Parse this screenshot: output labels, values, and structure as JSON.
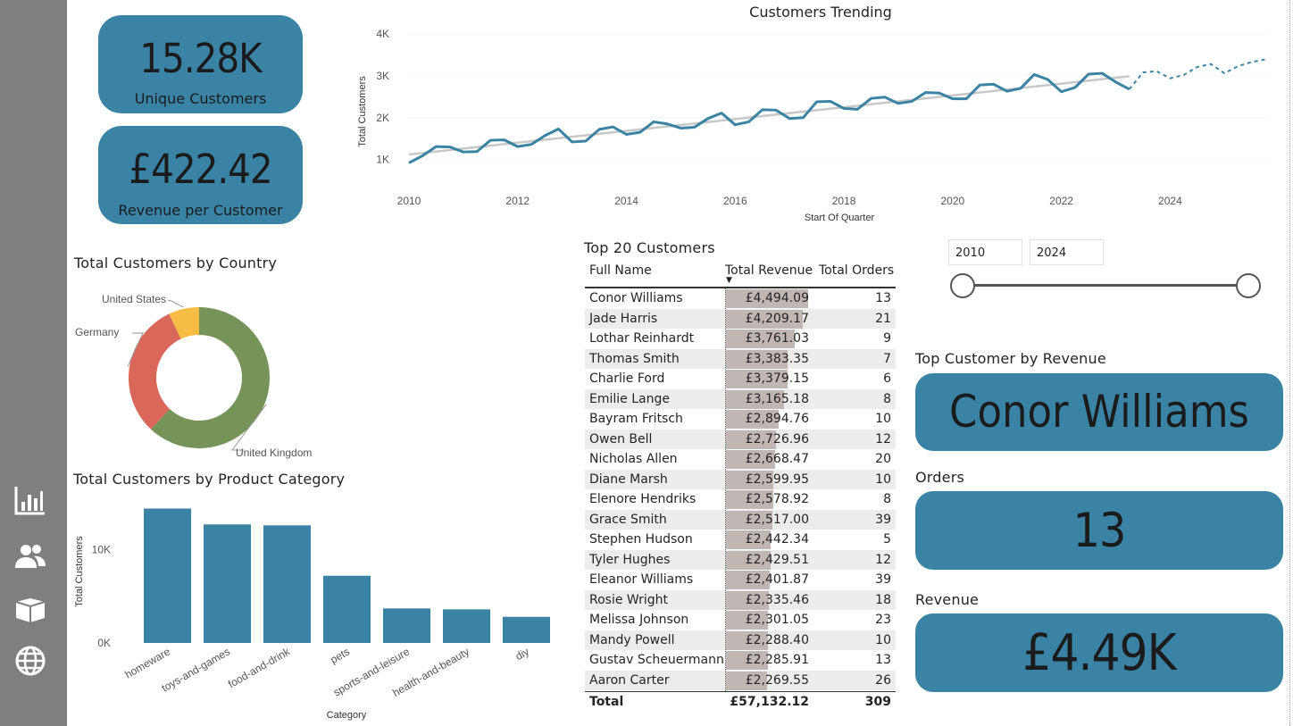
{
  "kpis": {
    "unique_customers_value": "15.28K",
    "unique_customers_label": "Unique Customers",
    "revenue_per_customer_value": "£422.42",
    "revenue_per_customer_label": "Revenue per Customer"
  },
  "nav": {
    "items": [
      {
        "icon": "bar-chart-icon"
      },
      {
        "icon": "users-icon"
      },
      {
        "icon": "box-icon"
      },
      {
        "icon": "globe-icon"
      }
    ]
  },
  "colors": {
    "accent": "#3b83a4",
    "sidebar": "#7f7f7f",
    "donut_uk": "#76935a",
    "donut_germany": "#d9685b",
    "donut_us": "#f7bc45",
    "trend_line": "#c8c8c8",
    "table_bar": "#c0b6b4"
  },
  "date_slicer": {
    "start": "2010",
    "end": "2024",
    "start_fraction": 0,
    "end_fraction": 1
  },
  "top_customer": {
    "title": "Top Customer by Revenue",
    "name": "Conor Williams",
    "orders_title": "Orders",
    "orders_value": "13",
    "revenue_title": "Revenue",
    "revenue_value": "£4.49K"
  },
  "top20": {
    "title": "Top 20 Customers",
    "columns": [
      "Full Name",
      "Total Revenue",
      "Total Orders"
    ],
    "sort_indicator": "▼",
    "rows": [
      {
        "name": "Conor Williams",
        "revenue": "£4,494.09",
        "revenue_num": 4494.09,
        "orders": "13"
      },
      {
        "name": "Jade Harris",
        "revenue": "£4,209.17",
        "revenue_num": 4209.17,
        "orders": "21"
      },
      {
        "name": "Lothar Reinhardt",
        "revenue": "£3,761.03",
        "revenue_num": 3761.03,
        "orders": "9"
      },
      {
        "name": "Thomas Smith",
        "revenue": "£3,383.35",
        "revenue_num": 3383.35,
        "orders": "7"
      },
      {
        "name": "Charlie Ford",
        "revenue": "£3,379.15",
        "revenue_num": 3379.15,
        "orders": "6"
      },
      {
        "name": "Emilie Lange",
        "revenue": "£3,165.18",
        "revenue_num": 3165.18,
        "orders": "8"
      },
      {
        "name": "Bayram Fritsch",
        "revenue": "£2,894.76",
        "revenue_num": 2894.76,
        "orders": "10"
      },
      {
        "name": "Owen Bell",
        "revenue": "£2,726.96",
        "revenue_num": 2726.96,
        "orders": "12"
      },
      {
        "name": "Nicholas Allen",
        "revenue": "£2,668.47",
        "revenue_num": 2668.47,
        "orders": "20"
      },
      {
        "name": "Diane Marsh",
        "revenue": "£2,599.95",
        "revenue_num": 2599.95,
        "orders": "10"
      },
      {
        "name": "Elenore Hendriks",
        "revenue": "£2,578.92",
        "revenue_num": 2578.92,
        "orders": "8"
      },
      {
        "name": "Grace Smith",
        "revenue": "£2,517.00",
        "revenue_num": 2517.0,
        "orders": "39"
      },
      {
        "name": "Stephen Hudson",
        "revenue": "£2,442.34",
        "revenue_num": 2442.34,
        "orders": "5"
      },
      {
        "name": "Tyler Hughes",
        "revenue": "£2,429.51",
        "revenue_num": 2429.51,
        "orders": "12"
      },
      {
        "name": "Eleanor Williams",
        "revenue": "£2,401.87",
        "revenue_num": 2401.87,
        "orders": "39"
      },
      {
        "name": "Rosie Wright",
        "revenue": "£2,335.46",
        "revenue_num": 2335.46,
        "orders": "18"
      },
      {
        "name": "Melissa Johnson",
        "revenue": "£2,301.05",
        "revenue_num": 2301.05,
        "orders": "23"
      },
      {
        "name": "Mandy Powell",
        "revenue": "£2,288.40",
        "revenue_num": 2288.4,
        "orders": "10"
      },
      {
        "name": "Gustav Scheuermann",
        "revenue": "£2,285.91",
        "revenue_num": 2285.91,
        "orders": "13"
      },
      {
        "name": "Aaron Carter",
        "revenue": "£2,269.55",
        "revenue_num": 2269.55,
        "orders": "26"
      }
    ],
    "total_label": "Total",
    "total_revenue": "£57,132.12",
    "total_orders": "309"
  },
  "chart_data": [
    {
      "type": "line",
      "title": "Customers Trending",
      "xlabel": "Start Of Quarter",
      "ylabel": "Total Customers",
      "x_ticks": [
        "2010",
        "2012",
        "2014",
        "2016",
        "2018",
        "2020",
        "2022",
        "2024"
      ],
      "y_ticks": [
        "1K",
        "2K",
        "3K",
        "4K"
      ],
      "xlim": [
        2010,
        2025.8
      ],
      "ylim": [
        800,
        4000
      ],
      "series": [
        {
          "values_x": [
            2010.0,
            2010.25,
            2010.5,
            2010.75,
            2011.0,
            2011.25,
            2011.5,
            2011.75,
            2012.0,
            2012.25,
            2012.5,
            2012.75,
            2013.0,
            2013.25,
            2013.5,
            2013.75,
            2014.0,
            2014.25,
            2014.5,
            2014.75,
            2015.0,
            2015.25,
            2015.5,
            2015.75,
            2016.0,
            2016.25,
            2016.5,
            2016.75,
            2017.0,
            2017.25,
            2017.5,
            2017.75,
            2018.0,
            2018.25,
            2018.5,
            2018.75,
            2019.0,
            2019.25,
            2019.5,
            2019.75,
            2020.0,
            2020.25,
            2020.5,
            2020.75,
            2021.0,
            2021.25,
            2021.5,
            2021.75,
            2022.0,
            2022.25,
            2022.5,
            2022.75,
            2023.0,
            2023.25
          ],
          "values_y": [
            920,
            1090,
            1310,
            1300,
            1180,
            1190,
            1460,
            1470,
            1310,
            1360,
            1570,
            1730,
            1420,
            1440,
            1720,
            1780,
            1600,
            1650,
            1900,
            1850,
            1750,
            1770,
            1980,
            2110,
            1830,
            1900,
            2190,
            2180,
            1980,
            2000,
            2380,
            2390,
            2220,
            2200,
            2460,
            2490,
            2340,
            2390,
            2600,
            2590,
            2450,
            2450,
            2780,
            2800,
            2630,
            2700,
            3030,
            2910,
            2620,
            2720,
            3040,
            3060,
            2850,
            2680
          ]
        },
        {
          "forecast_x": [
            2023.25,
            2023.5,
            2023.75,
            2024.0,
            2024.25,
            2024.5,
            2024.75,
            2025.0,
            2025.25,
            2025.5,
            2025.75
          ],
          "forecast_y": [
            2680,
            3080,
            3110,
            2940,
            3020,
            3210,
            3280,
            3060,
            3230,
            3330,
            3390
          ]
        },
        {
          "trend_x": [
            2010,
            2023.25
          ],
          "trend_y": [
            1120,
            2990
          ]
        }
      ]
    },
    {
      "type": "pie",
      "title": "Total Customers by Country",
      "categories": [
        "United Kingdom",
        "Germany",
        "United States"
      ],
      "values": [
        62,
        31,
        7
      ]
    },
    {
      "type": "bar",
      "title": "Total Customers by Product Category",
      "xlabel": "Category",
      "ylabel": "Total Customers",
      "categories": [
        "homeware",
        "toys-and-games",
        "food-and-drink",
        "pets",
        "sports-and-leisure",
        "health-and-beauty",
        "diy"
      ],
      "values": [
        14400,
        12700,
        12600,
        7200,
        3700,
        3600,
        2800
      ],
      "y_ticks": [
        "0K",
        "10K"
      ],
      "ylim": [
        0,
        15500
      ]
    }
  ]
}
